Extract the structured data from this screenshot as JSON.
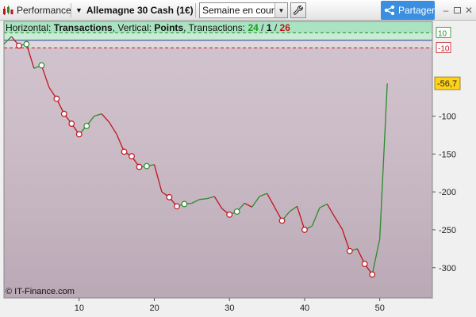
{
  "toolbar": {
    "performance_label": "Performance",
    "instrument_label": "Allemagne 30 Cash (1€)",
    "period_value": "Semaine en cours",
    "share_label": "Partager"
  },
  "header": {
    "horizontal_prefix": "Horizontal: ",
    "horizontal_value": "Transactions",
    "vertical_prefix": ", Vertical: ",
    "vertical_value": "Points",
    "transactions_prefix": ", Transactions: ",
    "win_count": "24",
    "slash1": " / ",
    "neutral_count": "1",
    "slash2": " / ",
    "loss_count": "26"
  },
  "copyright": "© IT-Finance.com",
  "colors": {
    "gain_zone": "#a9e3c1",
    "loss_zone": "#c9b8c4",
    "up_line": "#2a8c2a",
    "down_line": "#c0141e",
    "current_value_box": "#ffd21a"
  },
  "chart_data": {
    "type": "line",
    "xlabel": "",
    "ylabel": "",
    "xlim": [
      0,
      57
    ],
    "ylim": [
      -340,
      25
    ],
    "x_ticks": [
      10,
      20,
      30,
      40,
      50
    ],
    "y_ticks": [
      -100,
      -150,
      -200,
      -250,
      -300
    ],
    "thresholds": [
      {
        "label": "10",
        "value": 10,
        "color": "#2a8c2a"
      },
      {
        "label": "-10",
        "value": -10,
        "color": "#c0141e"
      }
    ],
    "current_value_label": "-56,7",
    "current_value": -56.7,
    "x": [
      1,
      2,
      3,
      4,
      5,
      6,
      7,
      8,
      9,
      10,
      11,
      12,
      13,
      14,
      15,
      16,
      17,
      18,
      19,
      20,
      21,
      22,
      23,
      24,
      25,
      26,
      27,
      28,
      29,
      30,
      31,
      32,
      33,
      34,
      35,
      36,
      37,
      38,
      39,
      40,
      41,
      42,
      43,
      44,
      45,
      46,
      47,
      48,
      49,
      50,
      51
    ],
    "y": [
      -5,
      5,
      -7,
      -5,
      -37,
      -33,
      -62,
      -77,
      -97,
      -110,
      -124,
      -113,
      -100,
      -97,
      -108,
      -124,
      -147,
      -153,
      -167,
      -166,
      -164,
      -200,
      -207,
      -219,
      -216,
      -215,
      -210,
      -209,
      -206,
      -222,
      -230,
      -226,
      -215,
      -220,
      -206,
      -202,
      -220,
      -238,
      -226,
      -219,
      -250,
      -245,
      -221,
      -216,
      -233,
      -249,
      -278,
      -275,
      -295,
      -309,
      -262,
      -57
    ],
    "markers": [
      2,
      3,
      5,
      7,
      8,
      9,
      10,
      11,
      16,
      17,
      18,
      19,
      22,
      23,
      24,
      30,
      31,
      37,
      40,
      46,
      48,
      49
    ]
  }
}
